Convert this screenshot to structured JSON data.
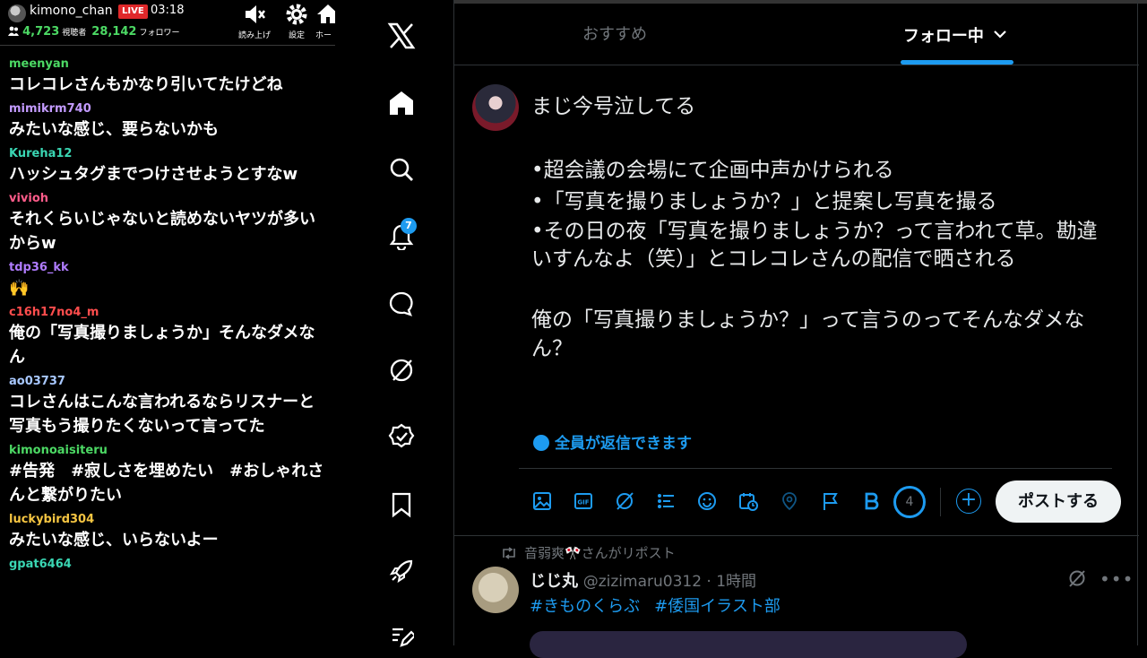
{
  "stream": {
    "channel_name": "kimono_chan",
    "live_label": "LIVE",
    "elapsed": "03:18",
    "viewers_count": "4,723",
    "viewers_label": "視聴者",
    "followers_count": "28,142",
    "followers_label": "フォロワー",
    "controls": [
      {
        "label": "読み上げ",
        "icon": "speaker-mute-icon"
      },
      {
        "label": "設定",
        "icon": "gear-icon"
      },
      {
        "label": "ホー",
        "icon": "home-icon"
      }
    ],
    "comments": [
      {
        "user": "meenyan",
        "color": "#4cd964",
        "text": "コレコレさんもかなり引いてたけどね"
      },
      {
        "user": "mimikrm740",
        "color": "#c39bff",
        "text": "みたいな感じ、要らないかも"
      },
      {
        "user": "Kureha12",
        "color": "#3ad6b3",
        "text": "ハッシュタグまでつけさせようとすなw"
      },
      {
        "user": "vivioh",
        "color": "#ff5c8a",
        "text": "それくらいじゃないと読めないヤツが多いからw"
      },
      {
        "user": "tdp36_kk",
        "color": "#b07cff",
        "text": "🙌"
      },
      {
        "user": "c16h17no4_m",
        "color": "#ff4d4d",
        "text": "俺の「写真撮りましょうか」そんなダメなん"
      },
      {
        "user": "ao03737",
        "color": "#a8c8ff",
        "text": "コレさんはこんな言われるならリスナーと写真もう撮りたくないって言ってた"
      },
      {
        "user": "kimonoaisiteru",
        "color": "#4cd964",
        "text": "#告発　#寂しさを埋めたい　#おしゃれさんと繋がりたい"
      },
      {
        "user": "luckybird304",
        "color": "#f5c542",
        "text": "みたいな感じ、いらないよー"
      },
      {
        "user": "gpat6464",
        "color": "#3ad6b3",
        "text": ""
      }
    ]
  },
  "xnav": {
    "notification_badge": "7",
    "items": [
      "x-logo-icon",
      "home-icon",
      "search-icon",
      "bell-icon",
      "message-icon",
      "grok-icon",
      "verified-icon",
      "bookmark-icon",
      "rocket-icon",
      "edit-icon"
    ]
  },
  "timeline": {
    "tabs": {
      "recommended": "おすすめ",
      "following": "フォロー中"
    },
    "compose": {
      "lines": [
        "まじ今号泣してる",
        "",
        "•超会議の会場にて企画中声かけられる",
        "•「写真を撮りましょうか？」と提案し写真を撮る",
        "•その日の夜「写真を撮りましょうか？って言われて草。勘違いすんなよ（笑）」とコレコレさんの配信で晒される",
        "",
        "俺の「写真撮りましょうか？」って言うのってそんなダメなん？"
      ],
      "reply_setting": "全員が返信できます",
      "char_counter": "4",
      "post_button": "ポストする"
    },
    "next_post": {
      "repost_by": "音弱爽🎌さんがリポスト",
      "name": "じじ丸",
      "handle": "@zizimaru0312 · 1時間",
      "tags": [
        "#きものくらぶ",
        "#倭国イラスト部"
      ]
    }
  },
  "colors": {
    "accent": "#1d9bf0",
    "live": "#e0282a",
    "count_green": "#4cd964"
  }
}
